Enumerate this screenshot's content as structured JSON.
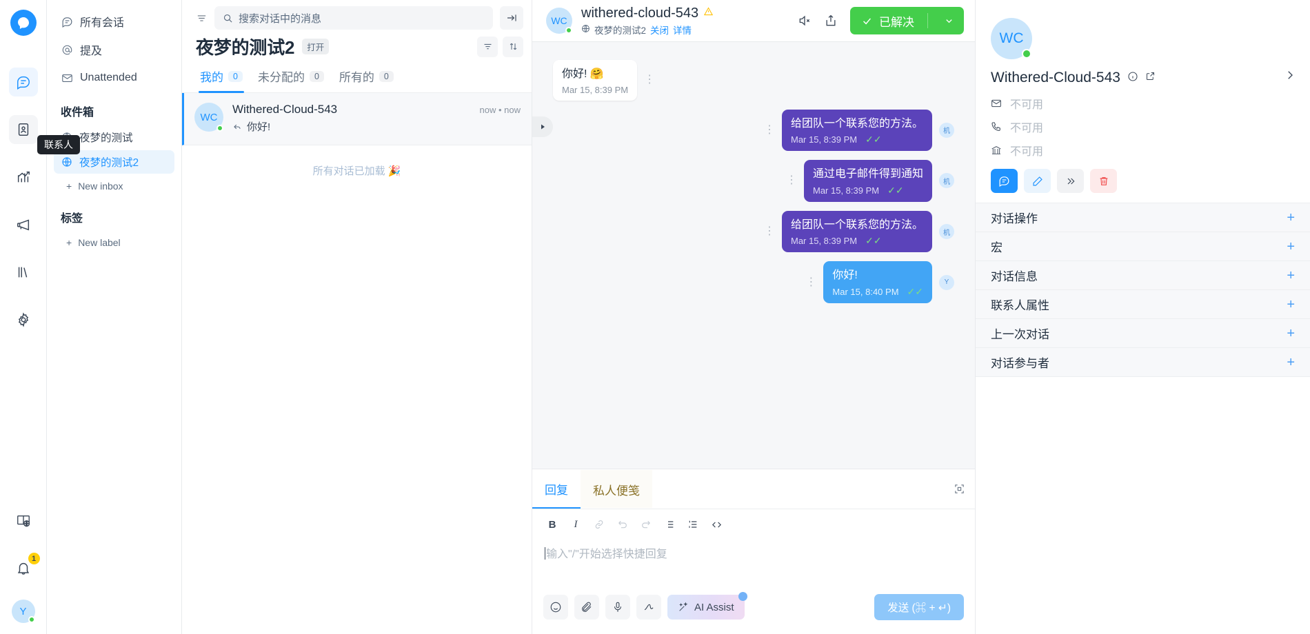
{
  "rail": {
    "logo_name": "chatwoot-logo",
    "items": [
      {
        "name": "conversations-icon",
        "active": true
      },
      {
        "name": "contacts-icon",
        "active": false
      },
      {
        "name": "reports-icon",
        "active": false
      },
      {
        "name": "campaigns-icon",
        "active": false
      },
      {
        "name": "help-center-icon",
        "active": false
      },
      {
        "name": "settings-icon",
        "active": false
      }
    ],
    "tooltip": "联系人",
    "bottom": {
      "docs_icon": "docs-globe-icon",
      "notification_icon": "bell-icon",
      "notification_count": "1",
      "avatar_initial": "Y"
    }
  },
  "sidenav": {
    "items": [
      {
        "label": "所有会话",
        "icon": "chat-bubble-icon"
      },
      {
        "label": "提及",
        "icon": "at-sign-icon"
      },
      {
        "label": "Unattended",
        "icon": "mail-icon"
      }
    ],
    "inbox_group_title": "收件箱",
    "inboxes": [
      {
        "label": "夜梦的测试",
        "selected": false
      },
      {
        "label": "夜梦的测试2",
        "selected": true
      }
    ],
    "new_inbox_label": "New inbox",
    "label_group_title": "标签",
    "new_label_label": "New label"
  },
  "convlist": {
    "search_placeholder": "搜索对话中的消息",
    "title": "夜梦的测试2",
    "status_chip": "打开",
    "tabs": [
      {
        "label": "我的",
        "count": "0",
        "active": true
      },
      {
        "label": "未分配的",
        "count": "0",
        "active": false
      },
      {
        "label": "所有的",
        "count": "0",
        "active": false
      }
    ],
    "rows": [
      {
        "initials": "WC",
        "name": "Withered-Cloud-543",
        "preview": "你好!",
        "time": "now • now",
        "selected": true
      }
    ],
    "end_text": "所有对话已加载 🎉"
  },
  "chat_header": {
    "initials": "WC",
    "title": "withered-cloud-543",
    "warning_icon": "warning-triangle-icon",
    "inbox_label": "夜梦的测试2",
    "close_label": "关闭",
    "details_label": "详情",
    "mute_icon": "mute-speaker-icon",
    "share_icon": "share-icon",
    "resolve_label": "已解决"
  },
  "messages": [
    {
      "direction": "in",
      "text": "你好! 🤗",
      "time": "Mar 15, 8:39 PM",
      "avatar": "",
      "status": ""
    },
    {
      "direction": "out",
      "text": "给团队一个联系您的方法。",
      "time": "Mar 15, 8:39 PM",
      "avatar": "机",
      "status": "✓✓",
      "variant": "bot"
    },
    {
      "direction": "out",
      "text": "通过电子邮件得到通知",
      "time": "Mar 15, 8:39 PM",
      "avatar": "机",
      "status": "✓✓",
      "variant": "bot"
    },
    {
      "direction": "out",
      "text": "给团队一个联系您的方法。",
      "time": "Mar 15, 8:39 PM",
      "avatar": "机",
      "status": "✓✓",
      "variant": "bot"
    },
    {
      "direction": "out",
      "text": "你好!",
      "time": "Mar 15, 8:40 PM",
      "avatar": "Y",
      "status": "✓✓",
      "variant": "agent"
    }
  ],
  "editor": {
    "tabs": [
      {
        "label": "回复",
        "active": true
      },
      {
        "label": "私人便笺",
        "active": false
      }
    ],
    "format_buttons": [
      {
        "name": "bold-icon",
        "glyph": "B",
        "dim": false
      },
      {
        "name": "italic-icon",
        "glyph": "I",
        "dim": false
      },
      {
        "name": "link-icon",
        "glyph": "🔗",
        "dim": true
      },
      {
        "name": "undo-icon",
        "glyph": "↺",
        "dim": true
      },
      {
        "name": "redo-icon",
        "glyph": "↻",
        "dim": true
      },
      {
        "name": "bullet-list-icon",
        "glyph": "≡",
        "dim": false
      },
      {
        "name": "numbered-list-icon",
        "glyph": "≡",
        "dim": false
      },
      {
        "name": "code-icon",
        "glyph": "</>",
        "dim": false
      }
    ],
    "placeholder": "输入\"/\"开始选择快捷回复",
    "tools": [
      {
        "name": "emoji-icon"
      },
      {
        "name": "attachment-icon"
      },
      {
        "name": "microphone-icon"
      },
      {
        "name": "signature-icon"
      }
    ],
    "ai_assist_label": "AI Assist",
    "send_label": "发送 (⌘ + ↵)"
  },
  "rightpanel": {
    "initials": "WC",
    "name": "Withered-Cloud-543",
    "fields": [
      {
        "icon": "mail-icon",
        "value": "不可用"
      },
      {
        "icon": "phone-icon",
        "value": "不可用"
      },
      {
        "icon": "company-icon",
        "value": "不可用"
      }
    ],
    "action_buttons": [
      {
        "name": "message-contact-button",
        "style": "primary"
      },
      {
        "name": "edit-contact-button",
        "style": "light"
      },
      {
        "name": "merge-contact-button",
        "style": "grey"
      },
      {
        "name": "delete-contact-button",
        "style": "danger"
      }
    ],
    "sections": [
      {
        "label": "对话操作"
      },
      {
        "label": "宏"
      },
      {
        "label": "对话信息"
      },
      {
        "label": "联系人属性"
      },
      {
        "label": "上一次对话"
      },
      {
        "label": "对话参与者"
      }
    ]
  },
  "colors": {
    "accent": "#1f93ff",
    "resolved": "#44ce4b",
    "bot_bubble": "#5b43ba",
    "agent_bubble": "#42a5f5",
    "danger": "#f04b4b"
  }
}
